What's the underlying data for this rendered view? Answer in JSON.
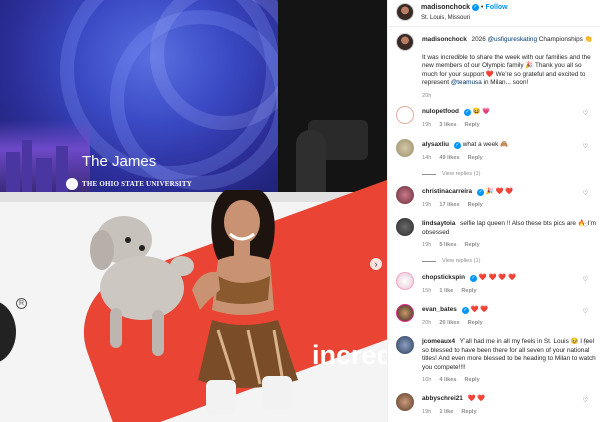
{
  "post": {
    "author": "madisonchock",
    "follow_label": "Follow",
    "location": "St. Louis, Missouri"
  },
  "photo": {
    "venue_text": "The James",
    "university_text": "THE OHIO STATE UNIVERSITY",
    "board_text": "incredi"
  },
  "caption": {
    "username": "madisonchock",
    "line1_pre": "2026",
    "line1_mention": "@usfigureskating",
    "line1_post": "Championships 👏",
    "body": "It was incredible to share the week with our families and the new members of our Olympic family 🎉 Thank you all so much for your support ❤️ We’re so grateful and excited to represent",
    "mention2": "@teamusa",
    "body_end": "in Milan... soon!",
    "time": "20h"
  },
  "comments": [
    {
      "username": "nulopetfood",
      "verified": true,
      "text": "😆 💗",
      "time": "19h",
      "likes": "3 likes",
      "reply": "Reply"
    },
    {
      "username": "alysaxliu",
      "verified": true,
      "text": "what a week 🙈",
      "time": "14h",
      "likes": "49 likes",
      "reply": "Reply",
      "view_replies": "View replies (1)"
    },
    {
      "username": "christinacarreira",
      "verified": true,
      "text": "🎉 ❤️ ❤️",
      "time": "19h",
      "likes": "17 likes",
      "reply": "Reply"
    },
    {
      "username": "lindsaytoia",
      "verified": false,
      "text": "selfie lap queen !! Also these bts pics are 🔥 I’m obsessed",
      "time": "19h",
      "likes": "5 likes",
      "reply": "Reply",
      "view_replies": "View replies (1)"
    },
    {
      "username": "chopstickspin",
      "verified": true,
      "text": "❤️ ❤️ ❤️ ❤️",
      "time": "15h",
      "likes": "1 like",
      "reply": "Reply"
    },
    {
      "username": "evan_bates",
      "verified": true,
      "text": "❤️ ❤️",
      "time": "20h",
      "likes": "20 likes",
      "reply": "Reply"
    },
    {
      "username": "jcomeaux4",
      "verified": false,
      "text": "Y’all had me in all my feels in St. Louis 🥹 I feel so blessed to have been there for all seven of your national titles! And even more blessed to be heading to Milan to watch you compete!!!!",
      "time": "16h",
      "likes": "4 likes",
      "reply": "Reply"
    },
    {
      "username": "abbyschrei21",
      "verified": false,
      "text": "❤️ ❤️",
      "time": "19h",
      "likes": "1 like",
      "reply": "Reply"
    }
  ],
  "colors": {
    "link": "#0095f6",
    "mention": "#00376b",
    "muted": "#8e8e8e",
    "board_red": "#e94434"
  },
  "icons": [
    "verified-badge-icon",
    "heart-icon",
    "next-arrow-icon"
  ]
}
